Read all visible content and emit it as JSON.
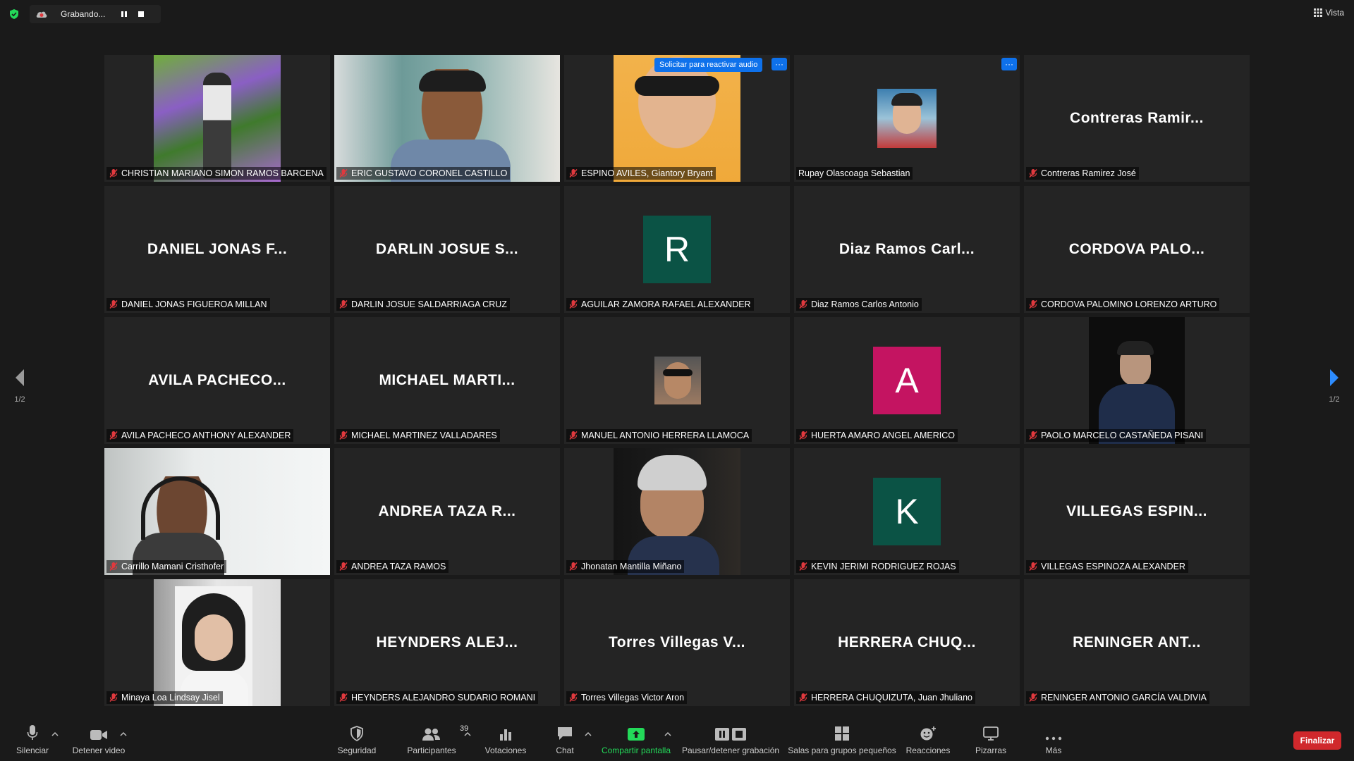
{
  "topbar": {
    "recording_label": "Grabando...",
    "view_label": "Vista"
  },
  "participants": [
    {
      "big": "",
      "name": "CHRISTIAN MARIANO SIMON RAMOS BARCENA",
      "type": "video-forest"
    },
    {
      "big": "",
      "name": "ERIC GUSTAVO CORONEL CASTILLO",
      "type": "video-speaker"
    },
    {
      "big": "",
      "name": "ESPINO AVILES, Giantory Bryant",
      "type": "video-yellow"
    },
    {
      "big": "",
      "name": "Rupay Olascoaga Sebastian",
      "type": "thumb"
    },
    {
      "big": "Contreras  Ramir...",
      "name": "Contreras Ramirez José",
      "type": "name"
    },
    {
      "big": "DANIEL  JONAS  F...",
      "name": "DANIEL JONAS FIGUEROA MILLAN",
      "type": "name"
    },
    {
      "big": "DARLIN  JOSUE  S...",
      "name": "DARLIN JOSUE SALDARRIAGA CRUZ",
      "type": "name"
    },
    {
      "big": "R",
      "name": "AGUILAR ZAMORA RAFAEL ALEXANDER",
      "type": "avatar",
      "color": "#0b5345"
    },
    {
      "big": "Diaz  Ramos  Carl...",
      "name": "Diaz Ramos Carlos Antonio",
      "type": "name"
    },
    {
      "big": "CORDOVA  PALO...",
      "name": "CORDOVA PALOMINO LORENZO ARTURO",
      "type": "name"
    },
    {
      "big": "AVILA  PACHECO...",
      "name": "AVILA PACHECO ANTHONY ALEXANDER",
      "type": "name"
    },
    {
      "big": "MICHAEL  MARTI...",
      "name": "MICHAEL MARTINEZ VALLADARES",
      "type": "name"
    },
    {
      "big": "",
      "name": "MANUEL ANTONIO HERRERA LLAMOCA",
      "type": "thumb-small"
    },
    {
      "big": "A",
      "name": "HUERTA AMARO ANGEL AMERICO",
      "type": "avatar",
      "color": "#c41461"
    },
    {
      "big": "",
      "name": "PAOLO MARCELO CASTAÑEDA PISANI",
      "type": "video-dark"
    },
    {
      "big": "",
      "name": "Carrillo Mamani Cristhofer",
      "type": "video-wall"
    },
    {
      "big": "ANDREA  TAZA  R...",
      "name": "ANDREA TAZA RAMOS",
      "type": "name"
    },
    {
      "big": "",
      "name": "Jhonatan Mantilla Miñano",
      "type": "video-cap"
    },
    {
      "big": "K",
      "name": "KEVIN JERIMI RODRIGUEZ ROJAS",
      "type": "avatar",
      "color": "#0b5345"
    },
    {
      "big": "VILLEGAS  ESPIN...",
      "name": "VILLEGAS ESPINOZA ALEXANDER",
      "type": "name"
    },
    {
      "big": "",
      "name": "Minaya Loa Lindsay Jisel",
      "type": "video-girl"
    },
    {
      "big": "HEYNDERS  ALEJ...",
      "name": "HEYNDERS ALEJANDRO SUDARIO ROMANI",
      "type": "name"
    },
    {
      "big": "Torres  Villegas  V...",
      "name": "Torres Villegas Victor Aron",
      "type": "name"
    },
    {
      "big": "HERRERA  CHUQ...",
      "name": "HERRERA CHUQUIZUTA, Juan Jhuliano",
      "type": "name"
    },
    {
      "big": "RENINGER  ANT...",
      "name": "RENINGER ANTONIO GARCÍA VALDIVIA",
      "type": "name"
    }
  ],
  "tile_overlays": {
    "unmute_request": "Solicitar para reactivar audio",
    "menu_glyph": "···"
  },
  "pagination": {
    "left": "1/2",
    "right": "1/2"
  },
  "toolbar": {
    "mute": "Silenciar",
    "video": "Detener video",
    "security": "Seguridad",
    "participants": "Participantes",
    "participants_count": "39",
    "polls": "Votaciones",
    "chat": "Chat",
    "share": "Compartir pantalla",
    "recording": "Pausar/detener grabación",
    "breakout": "Salas para grupos pequeños",
    "reactions": "Reacciones",
    "whiteboards": "Pizarras",
    "more": "Más",
    "end": "Finalizar"
  },
  "colors": {
    "background": "#1a1a1a",
    "tile": "#242424",
    "active_speaker": "#e9ef7a",
    "accent_blue": "#0e71eb",
    "share_green": "#23d959",
    "end_red": "#d0282c"
  }
}
